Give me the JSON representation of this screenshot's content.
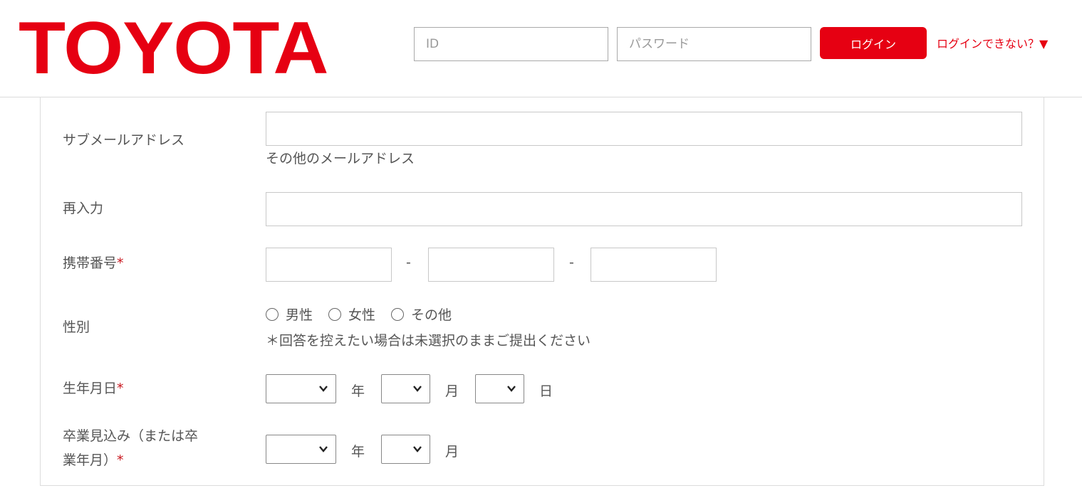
{
  "header": {
    "logo_text": "TOYOTA",
    "id_placeholder": "ID",
    "password_placeholder": "パスワード",
    "login_label": "ログイン",
    "cant_login_label": "ログインできない？▼"
  },
  "colors": {
    "brand": "#e60012",
    "required": "#c8161d"
  },
  "form": {
    "sub_email": {
      "label": "サブメールアドレス",
      "value": "",
      "note": "その他のメールアドレス"
    },
    "reenter": {
      "label": "再入力",
      "value": ""
    },
    "mobile": {
      "label": "携帯番号",
      "required_mark": "*",
      "separator": "-",
      "part1": "",
      "part2": "",
      "part3": ""
    },
    "gender": {
      "label": "性別",
      "options": [
        "男性",
        "女性",
        "その他"
      ],
      "note": "＊回答を控えたい場合は未選択のままご提出ください"
    },
    "birthdate": {
      "label": "生年月日",
      "required_mark": "*",
      "year_unit": "年",
      "month_unit": "月",
      "day_unit": "日",
      "year": "",
      "month": "",
      "day": ""
    },
    "graduation": {
      "label_line1": "卒業見込み（または卒",
      "label_line2": "業年月）",
      "required_mark": "*",
      "year_unit": "年",
      "month_unit": "月",
      "year": "",
      "month": ""
    }
  }
}
